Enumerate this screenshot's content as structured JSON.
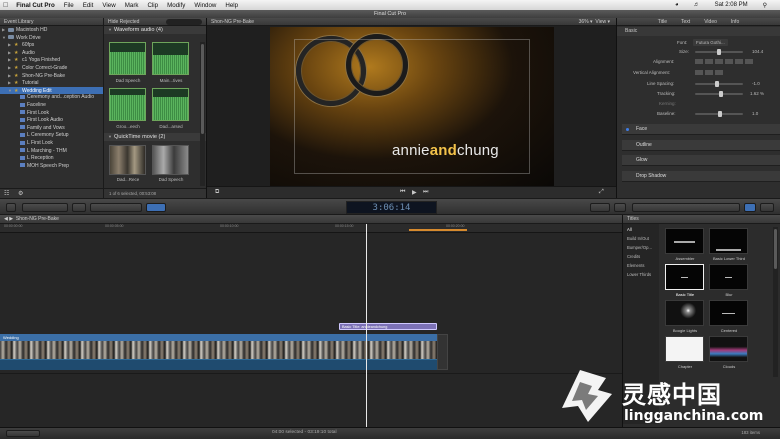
{
  "menubar": {
    "app": "Final Cut Pro",
    "items": [
      "File",
      "Edit",
      "View",
      "Mark",
      "Clip",
      "Modify",
      "Window",
      "Help"
    ],
    "clock": "Sat 2:08 PM"
  },
  "window": {
    "title": "Final Cut Pro"
  },
  "library": {
    "header": "Event Library",
    "rows": [
      {
        "label": "Macintosh HD",
        "indent": 0
      },
      {
        "label": "Work Drive",
        "indent": 0
      },
      {
        "label": "60fps",
        "indent": 1
      },
      {
        "label": "Audio",
        "indent": 1
      },
      {
        "label": "c1 Yoga Finished",
        "indent": 1
      },
      {
        "label": "Color Correct-Grade",
        "indent": 1
      },
      {
        "label": "Shon-NG Pre-Bake",
        "indent": 1
      },
      {
        "label": "Tutorial",
        "indent": 1
      },
      {
        "label": "Wedding Edit",
        "indent": 1,
        "selected": true
      },
      {
        "label": "Ceremony and...ception Audio",
        "indent": 2
      },
      {
        "label": "Faceline",
        "indent": 2
      },
      {
        "label": "First Look",
        "indent": 2
      },
      {
        "label": "First Look Audio",
        "indent": 2
      },
      {
        "label": "Family and Vows",
        "indent": 2
      },
      {
        "label": "L Ceremony Setup",
        "indent": 2
      },
      {
        "label": "L First Look",
        "indent": 2
      },
      {
        "label": "L Marching - THM",
        "indent": 2
      },
      {
        "label": "L Reception",
        "indent": 2
      },
      {
        "label": "MOH Speech Prep",
        "indent": 2
      }
    ]
  },
  "browser": {
    "filter": "Hide Rejected",
    "group1": "Waveform audio  (4)",
    "group2": "QuickTime movie  (2)",
    "clips": [
      "Dad Speech",
      "Main...tives",
      "Groo...eech",
      "Dad...arsed",
      "Dad...Rece",
      "Dad Speech"
    ],
    "status": "1 of 6 selected, 00:53:08"
  },
  "viewer": {
    "header": "Shon-NG Pre-Bake",
    "zoom": "36%",
    "view": "View",
    "title_a": "annie",
    "title_b": "and",
    "title_c": "chung"
  },
  "inspector": {
    "tabs": [
      "Title",
      "Text",
      "Video",
      "Info"
    ],
    "basic": "Basic",
    "font_label": "Font:",
    "font_value": "Futura Gothi...",
    "size_label": "Size:",
    "size_value": "104.4",
    "alignment": "Alignment:",
    "vertical": "Vertical Alignment:",
    "line_spacing": "Line Spacing:",
    "line_spacing_value": "-1.0",
    "tracking": "Tracking:",
    "tracking_value": "1.62 %",
    "kerning": "Kerning:",
    "baseline": "Baseline:",
    "baseline_value": "1.0",
    "sections": [
      "Face",
      "Outline",
      "Glow",
      "Drop Shadow"
    ]
  },
  "toolbar": {
    "timecode": "3:06:14"
  },
  "timeline": {
    "header": "Shon-NG Pre-Bake",
    "ticks": [
      "00:00:00:00",
      "00:00:05:00",
      "00:00:10:00",
      "00:00:15:00",
      "00:00:20:00"
    ],
    "title_clip": "Basic Title: annieandchung",
    "clip_label": "Wedding"
  },
  "titles": {
    "header": "Titles",
    "categories": [
      "All",
      "Build In/Out",
      "Bumper/Op...",
      "Credits",
      "Elements",
      "Lower Thirds"
    ],
    "items": [
      "Assembler",
      "Basic Lower Third",
      "Basic Title",
      "Blur",
      "Boogie Lights",
      "Centered",
      "Chapter",
      "Clouds"
    ],
    "count": "183 items"
  },
  "status_text": "04:00 selected - 03:19:10 total",
  "watermark": {
    "cn": "灵感中国",
    "en": "lingganchina.com"
  }
}
